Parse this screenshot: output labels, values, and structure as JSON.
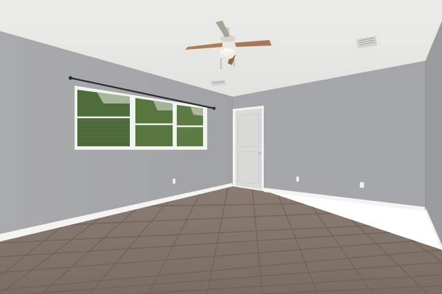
{
  "scene": {
    "subject": "empty-room-interior",
    "colors": {
      "ceiling": "#e9e9e6",
      "wall_left": "#a6a7a9",
      "wall_back": "#a4a5a8",
      "wall_right": "#9a9b9e",
      "floor": "#7f7268",
      "floor_grout": "#6e635b",
      "trim": "#f3f3f1",
      "door": "#d9d9d7",
      "foliage": "#4e6b3a",
      "fan_blade": "#a77a55"
    },
    "objects": [
      "ceiling-fan",
      "window",
      "curtain-rod",
      "door",
      "baseboard",
      "tile-floor",
      "air-vent",
      "electrical-outlet"
    ]
  }
}
